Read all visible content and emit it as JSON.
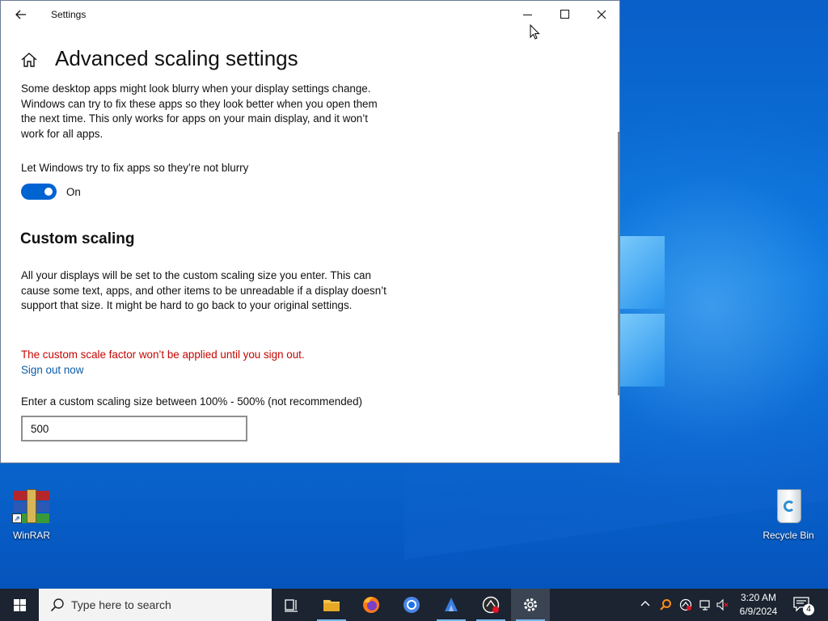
{
  "window": {
    "app_title": "Settings",
    "page_title": "Advanced scaling settings",
    "intro_text": "Some desktop apps might look blurry when your display settings change. Windows can try to fix these apps so they look better when you open them the next time. This only works for apps on your main display, and it won’t work for all apps.",
    "toggle": {
      "label": "Let Windows try to fix apps so they’re not blurry",
      "state_text": "On",
      "on": true
    },
    "custom_scaling": {
      "title": "Custom scaling",
      "description": "All your displays will be set to the custom scaling size you enter. This can cause some text, apps, and other items to be unreadable if a display doesn’t support that size. It might be hard to go back to your original settings.",
      "warning": "The custom scale factor won’t be applied until you sign out.",
      "sign_out_link": "Sign out now",
      "input_label": "Enter a custom scaling size between 100% - 500% (not recommended)",
      "input_value": "500"
    }
  },
  "desktop": {
    "icons": [
      {
        "label": "WinRAR",
        "icon": "winrar-icon"
      },
      {
        "label": "Recycle Bin",
        "icon": "recycle-bin-icon"
      }
    ]
  },
  "taskbar": {
    "search_placeholder": "Type here to search",
    "pinned": [
      "task-view-icon",
      "file-explorer-icon",
      "firefox-icon",
      "chrome-icon",
      "app-icon",
      "app-record-icon",
      "settings-icon"
    ],
    "clock_time": "3:20 AM",
    "clock_date": "6/9/2024",
    "notification_count": "4"
  },
  "colors": {
    "accent": "#0063d2",
    "warning": "#c50500",
    "link": "#0a5ca8",
    "taskbar": "#1b2430"
  }
}
